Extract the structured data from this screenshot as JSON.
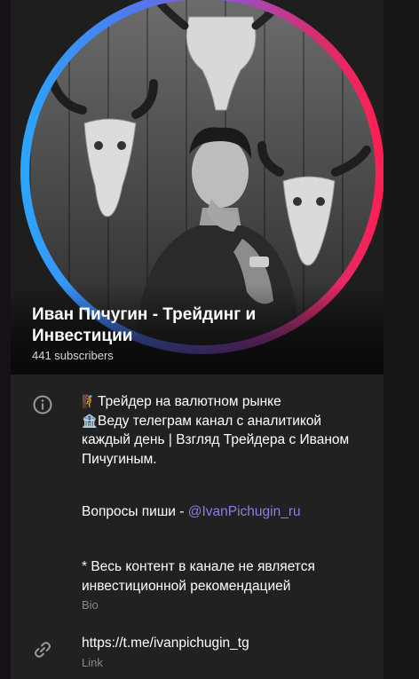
{
  "channel": {
    "name_line1": "Иван Пичугин - Трейдинг и",
    "name_line2": "Инвестиции",
    "subscribers": "441 subscribers"
  },
  "bio": {
    "line1_emoji": "🧗",
    "line1": "Трейдер на валютном рынке",
    "line2_emoji": "🏦",
    "line2": "Веду телеграм канал с аналитикой",
    "line3": "каждый день | Взгляд Трейдера с Иваном",
    "line4": "Пичугиным.",
    "questions_prefix": "Вопросы пиши - ",
    "questions_mention": "@IvanPichugin_ru",
    "disclaimer_line1": "* Весь контент в канале не является",
    "disclaimer_line2": "инвестиционной рекомендацией",
    "label": "Bio"
  },
  "link": {
    "url": "https://t.me/ivanpichugin_tg",
    "label": "Link"
  },
  "icons": {
    "info": "info-icon",
    "link": "link-icon"
  },
  "colors": {
    "panel_bg": "#212121",
    "mention": "#8f7ce6",
    "ring_start": "#2aa6ff",
    "ring_end": "#ff1f50"
  }
}
